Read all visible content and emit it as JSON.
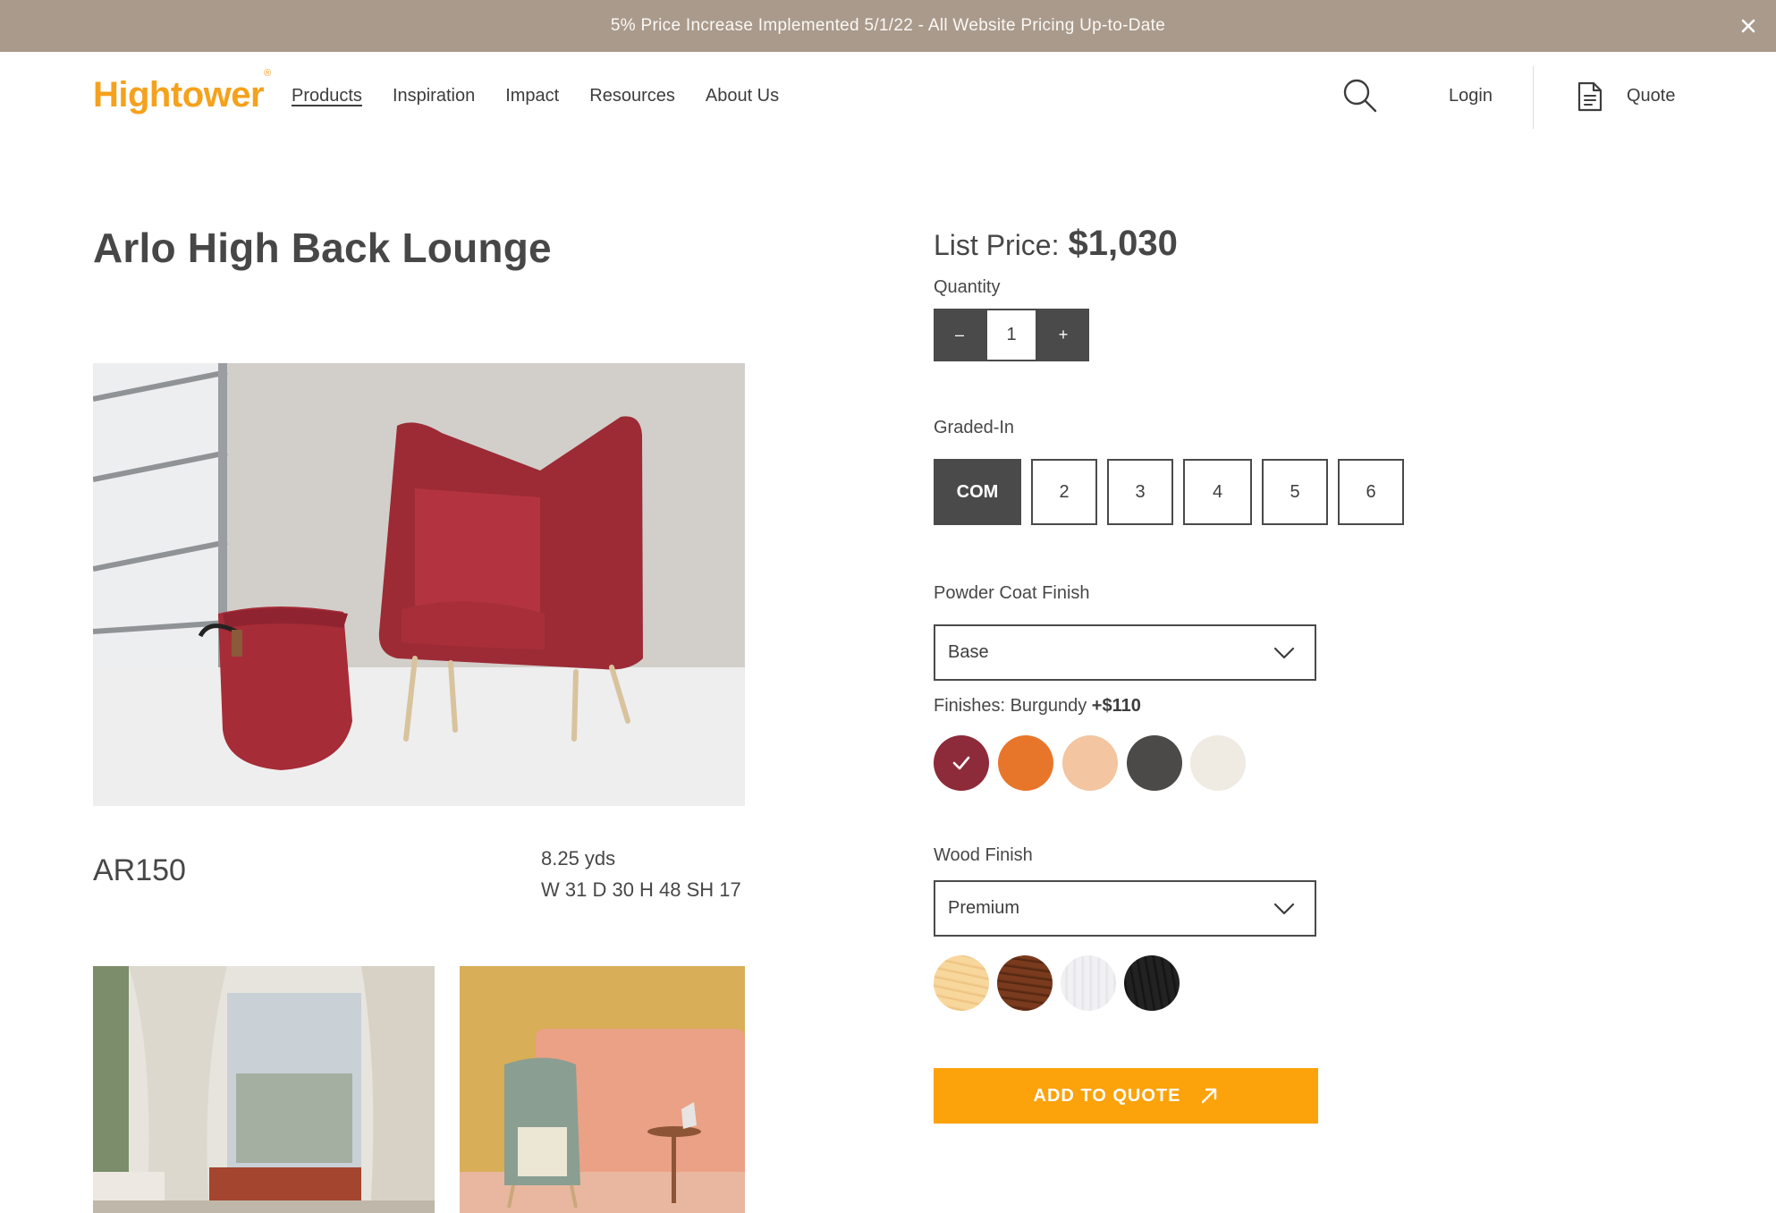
{
  "banner": {
    "text": "5% Price Increase Implemented 5/1/22 - All Website Pricing Up-to-Date",
    "close_icon": "close-icon"
  },
  "header": {
    "logo": "Hightower",
    "logo_mark": "®",
    "nav": [
      "Products",
      "Inspiration",
      "Impact",
      "Resources",
      "About Us"
    ],
    "active_nav": "Products",
    "search_icon": "search-icon",
    "login": "Login",
    "quote_icon": "document-icon",
    "quote": "Quote"
  },
  "product": {
    "title": "Arlo High Back Lounge",
    "sku": "AR150",
    "yardage": "8.25 yds",
    "dimensions": "W 31 D 30 H 48 SH 17"
  },
  "pricing": {
    "label": "List Price:",
    "value": "$1,030"
  },
  "quantity": {
    "label": "Quantity",
    "minus": "–",
    "value": "1",
    "plus": "+"
  },
  "graded_in": {
    "label": "Graded-In",
    "options": [
      "COM",
      "2",
      "3",
      "4",
      "5",
      "6"
    ],
    "selected": "COM"
  },
  "powder_coat": {
    "label": "Powder Coat Finish",
    "selected": "Base"
  },
  "finishes": {
    "label": "Finishes: Burgundy",
    "upcharge": "+$110",
    "swatches": [
      {
        "color": "#8d2b3a",
        "selected": true
      },
      {
        "color": "#e8762a",
        "selected": false
      },
      {
        "color": "#f3c5a0",
        "selected": false
      },
      {
        "color": "#4b4a48",
        "selected": false
      },
      {
        "color": "#efebe3",
        "selected": false
      }
    ]
  },
  "wood_finish": {
    "label": "Wood Finish",
    "selected": "Premium",
    "swatches": [
      {
        "color": "#f6cf92",
        "name": "light-wood"
      },
      {
        "color": "#6b3219",
        "name": "walnut"
      },
      {
        "color": "#eeeef1",
        "name": "white-wash"
      },
      {
        "color": "#1f1f1f",
        "name": "black"
      }
    ]
  },
  "cta": {
    "label": "ADD TO QUOTE",
    "icon": "arrow-up-right-icon"
  },
  "colors": {
    "brand_orange": "#fca20b",
    "banner_bg": "#a99a8c",
    "dark_gray": "#4a4a4a"
  }
}
